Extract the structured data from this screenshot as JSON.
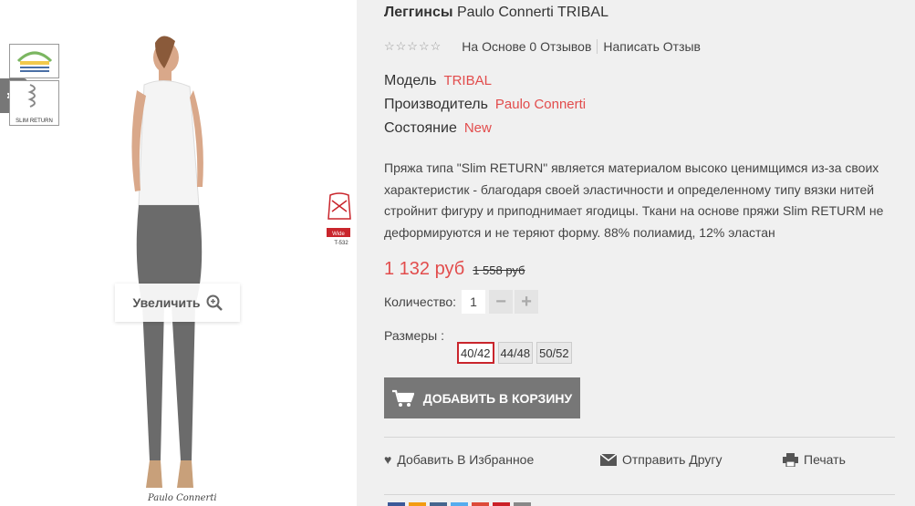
{
  "product": {
    "type_label": "Леггинсы",
    "name": "Paulo Connerti TRIBAL",
    "brand_sign": "Paulo Connerti"
  },
  "image_panel": {
    "zoom_label": "Увеличить",
    "badge_slim_label": "SLIM RETURN",
    "badge_wide_label": "Wide",
    "badge_wide_code": "T-532"
  },
  "rating": {
    "stars": "☆☆☆☆☆",
    "reviews_text": "На Основе 0 Отзывов",
    "write_review": "Написать Отзыв"
  },
  "specs": [
    {
      "label": "Модель",
      "value": "TRIBAL"
    },
    {
      "label": "Производитель",
      "value": "Paulo Connerti"
    },
    {
      "label": "Состояние",
      "value": "New"
    }
  ],
  "description": "Пряжа типа \"Slim RETURN\" является материалом высоко ценимщимся из-за своих характеристик - благодаря своей эластичности и определенному типу вязки нитей стройнит фигуру и приподнимает ягодицы. Ткани на основе пряжи Slim RETURM не деформируются и не теряют форму. 88% полиамид, 12% эластан",
  "price": {
    "current": "1 132 руб",
    "old": "1 558 руб"
  },
  "quantity": {
    "label": "Количество:",
    "value": "1",
    "minus": "−",
    "plus": "+"
  },
  "sizes": {
    "label": "Размеры :",
    "options": [
      "40/42",
      "44/48",
      "50/52"
    ],
    "selected": "40/42"
  },
  "cart": {
    "label": "ДОБАВИТЬ В КОРЗИНУ"
  },
  "actions": {
    "wishlist": "Добавить В Избранное",
    "send_friend": "Отправить Другу",
    "print": "Печать"
  },
  "colors": {
    "accent_red": "#e24c4c",
    "button_gray": "#777777",
    "size_selected_border": "#c9252c"
  }
}
